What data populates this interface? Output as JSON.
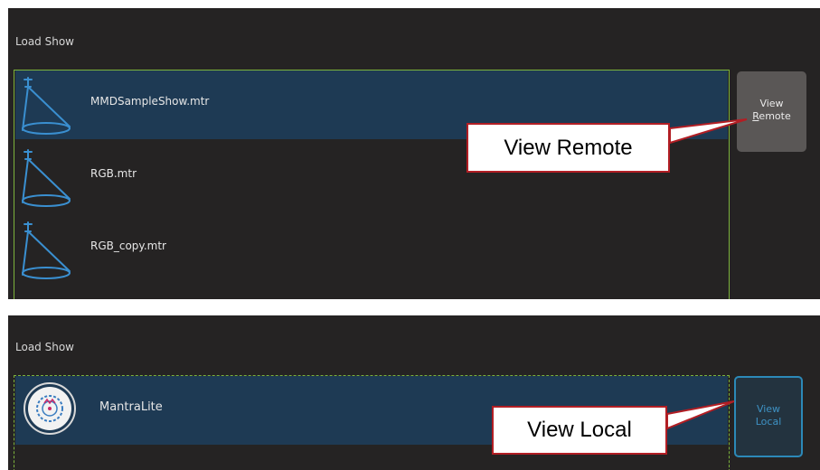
{
  "top_panel": {
    "title": "Load Show",
    "files": [
      {
        "name": "MMDSampleShow.mtr",
        "selected": true,
        "icon": "spotlight-icon"
      },
      {
        "name": "RGB.mtr",
        "selected": false,
        "icon": "spotlight-icon"
      },
      {
        "name": "RGB_copy.mtr",
        "selected": false,
        "icon": "spotlight-icon"
      }
    ],
    "view_button": {
      "line1": "View",
      "line2": "Remote",
      "mnemonic": "R"
    }
  },
  "bottom_panel": {
    "title": "Load Show",
    "items": [
      {
        "name": "MantraLite",
        "selected": true,
        "icon": "mantra-logo-icon"
      }
    ],
    "view_button": {
      "line1": "View",
      "line2": "Local"
    }
  },
  "callouts": {
    "remote": "View Remote",
    "local": "View Local"
  },
  "colors": {
    "panel_bg": "#252323",
    "selected_row": "#1e3a54",
    "list_border": "#7cb33c",
    "icon_blue": "#3a8fd0",
    "callout_border": "#b21e24",
    "local_button_border": "#2c89b8"
  }
}
